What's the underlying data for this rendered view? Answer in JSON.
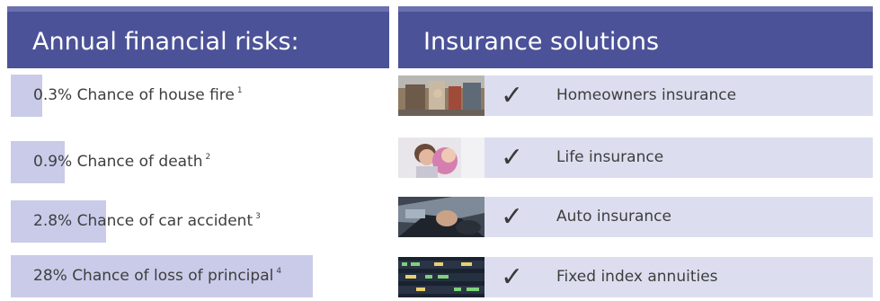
{
  "left_header": {
    "title": "Annual financial risks:"
  },
  "right_header": {
    "title": "Insurance solutions"
  },
  "risks": [
    {
      "percent_value": 0.3,
      "text": "0.3% Chance of house fire",
      "note": "1"
    },
    {
      "percent_value": 0.9,
      "text": "0.9% Chance of death",
      "note": "2"
    },
    {
      "percent_value": 2.8,
      "text": "2.8% Chance of car accident",
      "note": "3"
    },
    {
      "percent_value": 28,
      "text": "28% Chance of loss of principal",
      "note": "4"
    }
  ],
  "solutions": [
    {
      "photo": "house-fire-photo",
      "check": "✓",
      "label": "Homeowners insurance"
    },
    {
      "photo": "family-photo",
      "check": "✓",
      "label": "Life insurance"
    },
    {
      "photo": "car-driving-photo",
      "check": "✓",
      "label": "Auto insurance"
    },
    {
      "photo": "stock-ticker-photo",
      "check": "✓",
      "label": "Fixed index annuities"
    }
  ],
  "colors": {
    "header_bg": "#4b5298",
    "risk_bar": "#c9cbe9",
    "solution_row_bg": "#dcdef0"
  }
}
